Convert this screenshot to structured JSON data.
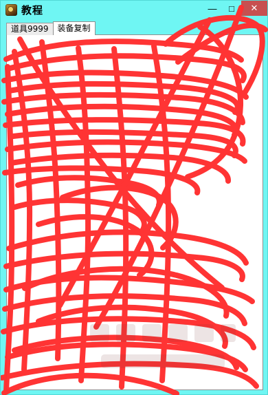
{
  "window": {
    "title": "教程",
    "icon": "app-icon",
    "controls": {
      "minimize": "—",
      "maximize": "□",
      "close": "✕"
    }
  },
  "tabs": [
    {
      "label": "道具9999",
      "active": false
    },
    {
      "label": "装备复制",
      "active": true
    }
  ],
  "colors": {
    "title_bar": "#6ff6f3",
    "panel": "#ffffff",
    "tab_inactive": "#ececec",
    "close_button": "#c75050",
    "redaction": "#ff3030"
  }
}
